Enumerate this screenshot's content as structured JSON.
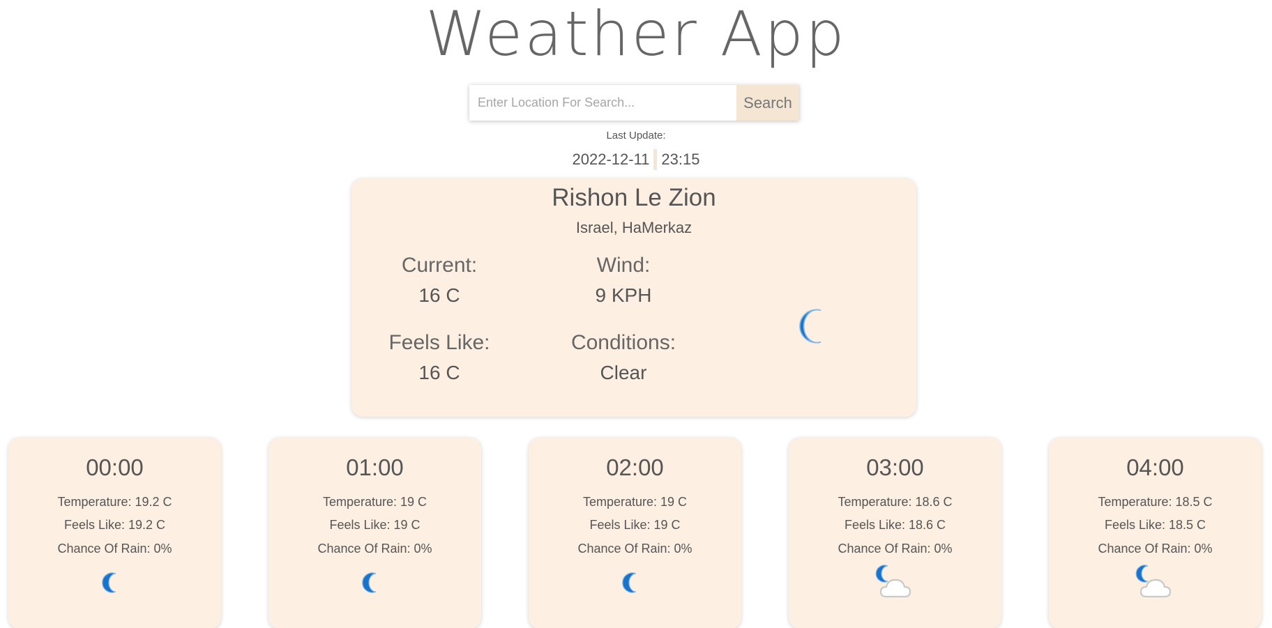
{
  "header": {
    "title": "Weather App"
  },
  "search": {
    "placeholder": "Enter Location For Search...",
    "value": "",
    "button_label": "Search"
  },
  "last_update": {
    "label": "Last Update:",
    "date": "2022-12-11",
    "time": "23:15"
  },
  "current": {
    "city": "Rishon Le Zion",
    "region": "Israel, HaMerkaz",
    "current_label": "Current:",
    "current_value": "16 C",
    "wind_label": "Wind:",
    "wind_value": "9 KPH",
    "feels_label": "Feels Like:",
    "feels_value": "16 C",
    "conditions_label": "Conditions:",
    "conditions_value": "Clear",
    "icon": "moon-icon"
  },
  "hourly": [
    {
      "time": "00:00",
      "temperature": "Temperature: 19.2 C",
      "feels_like": "Feels Like: 19.2 C",
      "chance_of_rain": "Chance Of Rain: 0%",
      "icon": "moon-icon"
    },
    {
      "time": "01:00",
      "temperature": "Temperature: 19 C",
      "feels_like": "Feels Like: 19 C",
      "chance_of_rain": "Chance Of Rain: 0%",
      "icon": "moon-icon"
    },
    {
      "time": "02:00",
      "temperature": "Temperature: 19 C",
      "feels_like": "Feels Like: 19 C",
      "chance_of_rain": "Chance Of Rain: 0%",
      "icon": "moon-icon"
    },
    {
      "time": "03:00",
      "temperature": "Temperature: 18.6 C",
      "feels_like": "Feels Like: 18.6 C",
      "chance_of_rain": "Chance Of Rain: 0%",
      "icon": "moon-cloud-icon"
    },
    {
      "time": "04:00",
      "temperature": "Temperature: 18.5 C",
      "feels_like": "Feels Like: 18.5 C",
      "chance_of_rain": "Chance Of Rain: 0%",
      "icon": "moon-cloud-icon"
    }
  ],
  "colors": {
    "card_bg": "#fdf0e3",
    "accent": "#f5e6d3",
    "icon_blue": "#1a73c9"
  }
}
